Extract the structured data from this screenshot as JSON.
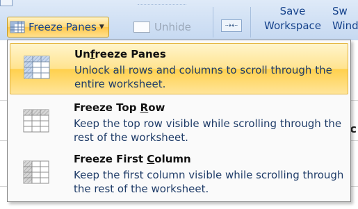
{
  "ribbon": {
    "freeze_label": "Freeze Panes",
    "unhide_label": "Unhide",
    "save_workspace_line1": "Save",
    "save_workspace_line2": "Workspace",
    "switch_windows_line1": "Sw",
    "switch_windows_line2": "Wind"
  },
  "sheet": {
    "partial_text": "c"
  },
  "menu": {
    "items": [
      {
        "title_pre": "Un",
        "title_key": "f",
        "title_post": "reeze Panes",
        "desc": "Unlock all rows and columns to scroll through the entire worksheet.",
        "icon": "unfreeze-panes-icon",
        "active": true
      },
      {
        "title_pre": "Freeze Top ",
        "title_key": "R",
        "title_post": "ow",
        "desc": "Keep the top row visible while scrolling through the rest of the worksheet.",
        "icon": "freeze-top-row-icon",
        "active": false
      },
      {
        "title_pre": "Freeze First ",
        "title_key": "C",
        "title_post": "olumn",
        "desc": "Keep the first column visible while scrolling through the rest of the worksheet.",
        "icon": "freeze-first-column-icon",
        "active": false
      }
    ]
  },
  "colors": {
    "highlight": "#ffd04d",
    "ribbon_text": "#15428b",
    "desc_text": "#1f3c68"
  }
}
